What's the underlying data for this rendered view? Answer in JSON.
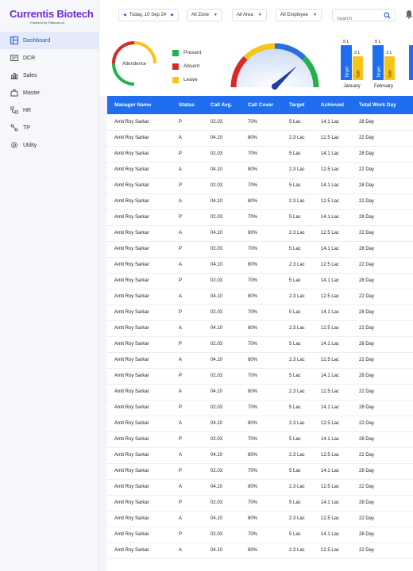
{
  "brand": {
    "title": "Currentis Biotech",
    "subtitle": "Powered by Pinbearn AI"
  },
  "sidebar": {
    "items": [
      {
        "label": "Dashboard",
        "icon": "dashboard-icon",
        "active": true
      },
      {
        "label": "DCR",
        "icon": "dcr-icon",
        "active": false
      },
      {
        "label": "Sales",
        "icon": "sales-chart-icon",
        "active": false
      },
      {
        "label": "Master",
        "icon": "master-icon",
        "active": false
      },
      {
        "label": "HR",
        "icon": "hr-icon",
        "active": false
      },
      {
        "label": "TP",
        "icon": "tp-icon",
        "active": false
      },
      {
        "label": "Utility",
        "icon": "gear-icon",
        "active": false
      }
    ]
  },
  "topbar": {
    "date_label": "Today, 10 Sep 24",
    "zone_label": "All Zone",
    "area_label": "All Area",
    "employee_label": "All Employee",
    "search_placeholder": "Search"
  },
  "attendance": {
    "center_label": "Attendence",
    "legend": [
      {
        "label": "Present",
        "color": "#22b14c"
      },
      {
        "label": "Absent",
        "color": "#d62b2b"
      },
      {
        "label": "Leave",
        "color": "#f5c518"
      }
    ]
  },
  "gauge": {
    "colors": [
      "#d62b2b",
      "#f5c518",
      "#2a6fe0",
      "#22b14c"
    ]
  },
  "mini_bars": {
    "months": [
      {
        "month": "January",
        "target_value": "5 L",
        "sale_value": "2 L",
        "target_label": "Target",
        "sale_label": "Sale"
      },
      {
        "month": "February",
        "target_value": "5 L",
        "sale_value": "2 L",
        "target_label": "Target",
        "sale_label": "Sale"
      }
    ],
    "target_color": "#1f6ef0",
    "sale_color": "#f5c518"
  },
  "table": {
    "columns": [
      "Manager Name",
      "Status",
      "Call Avg.",
      "Call Cover",
      "Target",
      "Achieved",
      "Total Work Day"
    ],
    "rows": [
      [
        "Amit Roy Sarkar",
        "P",
        "02.03",
        "70%",
        "5 Lac",
        "14.1 Lac",
        "28 Day"
      ],
      [
        "Amit Roy Sarkar",
        "A",
        "04.10",
        "80%",
        "2.3 Lac",
        "12.5 Lac",
        "22 Day"
      ],
      [
        "Amit Roy Sarkar",
        "P",
        "02.03",
        "70%",
        "5 Lac",
        "14.1 Lac",
        "28 Day"
      ],
      [
        "Amit Roy Sarkar",
        "A",
        "04.10",
        "80%",
        "2.3 Lac",
        "12.5 Lac",
        "22 Day"
      ],
      [
        "Amit Roy Sarkar",
        "P",
        "02.03",
        "70%",
        "5 Lac",
        "14.1 Lac",
        "28 Day"
      ],
      [
        "Amit Roy Sarkar",
        "A",
        "04.10",
        "80%",
        "2.3 Lac",
        "12.5 Lac",
        "22 Day"
      ],
      [
        "Amit Roy Sarkar",
        "P",
        "02.03",
        "70%",
        "5 Lac",
        "14.1 Lac",
        "28 Day"
      ],
      [
        "Amit Roy Sarkar",
        "A",
        "04.10",
        "80%",
        "2.3 Lac",
        "12.5 Lac",
        "22 Day"
      ],
      [
        "Amit Roy Sarkar",
        "P",
        "02.03",
        "70%",
        "5 Lac",
        "14.1 Lac",
        "28 Day"
      ],
      [
        "Amit Roy Sarkar",
        "A",
        "04.10",
        "80%",
        "2.3 Lac",
        "12.5 Lac",
        "22 Day"
      ],
      [
        "Amit Roy Sarkar",
        "P",
        "02.03",
        "70%",
        "5 Lac",
        "14.1 Lac",
        "28 Day"
      ],
      [
        "Amit Roy Sarkar",
        "A",
        "04.10",
        "80%",
        "2.3 Lac",
        "12.5 Lac",
        "22 Day"
      ],
      [
        "Amit Roy Sarkar",
        "P",
        "02.03",
        "70%",
        "5 Lac",
        "14.1 Lac",
        "28 Day"
      ],
      [
        "Amit Roy Sarkar",
        "A",
        "04.10",
        "80%",
        "2.3 Lac",
        "12.5 Lac",
        "22 Day"
      ],
      [
        "Amit Roy Sarkar",
        "P",
        "02.03",
        "70%",
        "5 Lac",
        "14.1 Lac",
        "28 Day"
      ],
      [
        "Amit Roy Sarkar",
        "A",
        "04.10",
        "80%",
        "2.3 Lac",
        "12.5 Lac",
        "22 Day"
      ],
      [
        "Amit Roy Sarkar",
        "P",
        "02.03",
        "70%",
        "5 Lac",
        "14.1 Lac",
        "28 Day"
      ],
      [
        "Amit Roy Sarkar",
        "A",
        "04.10",
        "80%",
        "2.3 Lac",
        "12.5 Lac",
        "22 Day"
      ],
      [
        "Amit Roy Sarkar",
        "P",
        "02.03",
        "70%",
        "5 Lac",
        "14.1 Lac",
        "28 Day"
      ],
      [
        "Amit Roy Sarkar",
        "A",
        "04.10",
        "80%",
        "2.3 Lac",
        "12.5 Lac",
        "22 Day"
      ],
      [
        "Amit Roy Sarkar",
        "P",
        "02.03",
        "70%",
        "5 Lac",
        "14.1 Lac",
        "28 Day"
      ],
      [
        "Amit Roy Sarkar",
        "A",
        "04.10",
        "80%",
        "2.3 Lac",
        "12.5 Lac",
        "22 Day"
      ],
      [
        "Amit Roy Sarkar",
        "P",
        "02.03",
        "70%",
        "5 Lac",
        "14.1 Lac",
        "28 Day"
      ],
      [
        "Amit Roy Sarkar",
        "A",
        "04.10",
        "80%",
        "2.3 Lac",
        "12.5 Lac",
        "22 Day"
      ],
      [
        "Amit Roy Sarkar",
        "P",
        "02.03",
        "70%",
        "5 Lac",
        "14.1 Lac",
        "28 Day"
      ],
      [
        "Amit Roy Sarkar",
        "A",
        "04.10",
        "80%",
        "2.3 Lac",
        "12.5 Lac",
        "22 Day"
      ],
      [
        "Amit Roy Sarkar",
        "P",
        "02.03",
        "70%",
        "5 Lac",
        "14.1 Lac",
        "28 Day"
      ],
      [
        "Amit Roy Sarkar",
        "A",
        "04.10",
        "80%",
        "2.3 Lac",
        "12.5 Lac",
        "22 Day"
      ]
    ]
  }
}
